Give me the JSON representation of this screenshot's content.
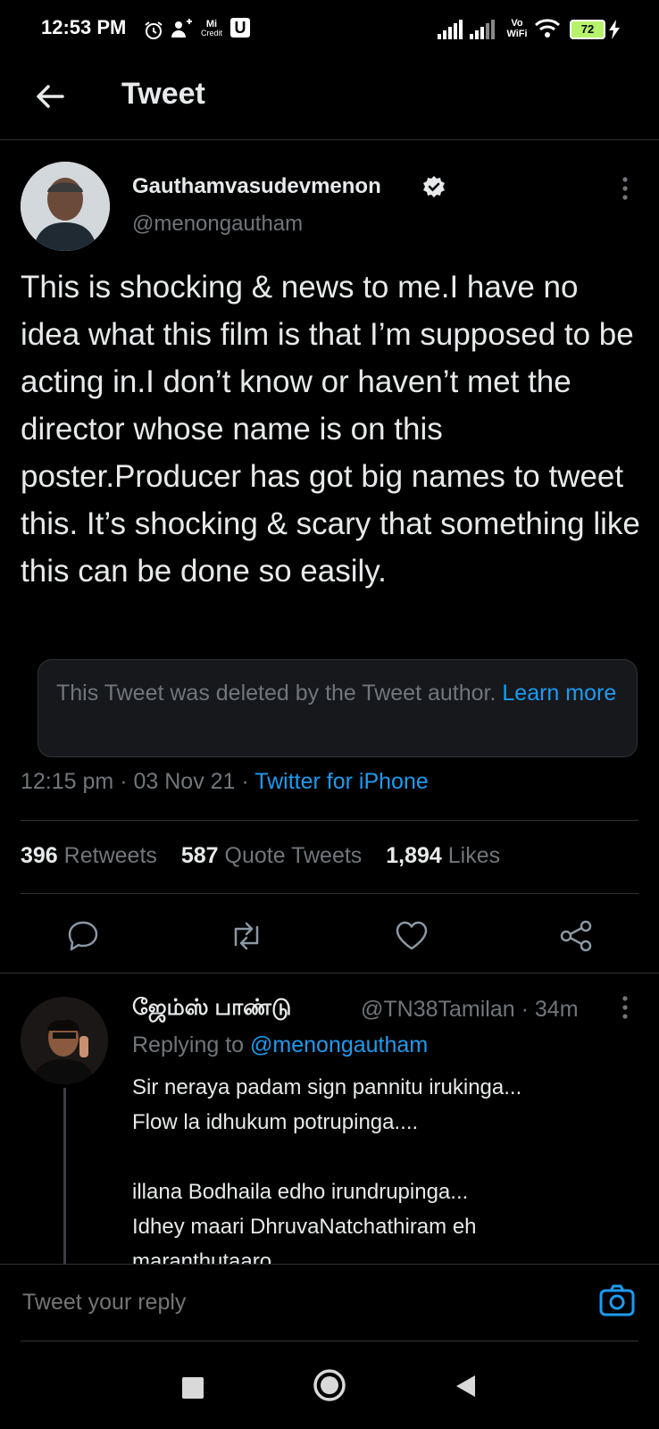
{
  "status_bar": {
    "time": "12:53 PM",
    "battery": "72",
    "icons": [
      "alarm-icon",
      "person-add-icon",
      "mi-credit-icon",
      "u-app-icon",
      "signal-icon",
      "signal-icon",
      "vowifi-icon",
      "wifi-icon",
      "battery-icon",
      "charging-icon"
    ],
    "vowifi_label": "Vo WiFi",
    "mi_credit_label": "Credit"
  },
  "header": {
    "title": "Tweet"
  },
  "tweet": {
    "display_name": "Gauthamvasudevmenon",
    "handle": "@menongautham",
    "text": "This is shocking & news to me.I have no idea what this film is that I’m supposed to be acting in.I don’t know or haven’t met the director whose name is on this poster.Producer has got big names to tweet this. It’s shocking & scary that something like this can be done so easily.",
    "quote_notice": "This Tweet was deleted by the Tweet author.",
    "quote_link": "Learn more",
    "time": "12:15 pm",
    "date": "03 Nov 21",
    "source": "Twitter for iPhone",
    "retweets_count": "396",
    "retweets_label": "Retweets",
    "quotes_count": "587",
    "quotes_label": "Quote Tweets",
    "likes_count": "1,894",
    "likes_label": "Likes"
  },
  "reply": {
    "display_name": "ஜேம்ஸ் பாண்டு",
    "handle": "@TN38Tamilan",
    "time": "34m",
    "replying_prefix": "Replying to",
    "replying_to": "@menongautham",
    "text": "Sir neraya padam sign pannitu irukinga...\nFlow la idhukum potrupinga....\n\nillana Bodhaila edho irundrupinga...\nIdhey maari DhruvaNatchathiram eh\nmaranthutaaro...."
  },
  "composer": {
    "placeholder": "Tweet your reply"
  },
  "colors": {
    "background": "#000000",
    "accent": "#1d9bf0",
    "muted": "#71767b",
    "text": "#e7e9ea",
    "divider": "#2f3336"
  }
}
